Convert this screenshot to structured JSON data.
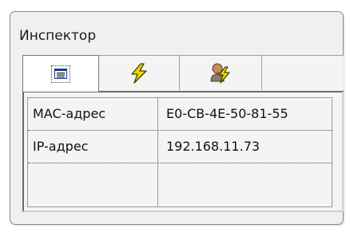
{
  "window": {
    "title": "Инспектор"
  },
  "tabs": [
    {
      "icon": "list-icon",
      "active": true
    },
    {
      "icon": "lightning-icon",
      "active": false
    },
    {
      "icon": "user-lightning-icon",
      "active": false
    }
  ],
  "properties": [
    {
      "name": "MAC-адрес",
      "value": "E0-CB-4E-50-81-55"
    },
    {
      "name": "IP-адрес",
      "value": "192.168.11.73"
    }
  ],
  "colors": {
    "lightning": "#f2d200",
    "lightning_outline": "#404000",
    "user_shirt": "#8a7a6a"
  }
}
